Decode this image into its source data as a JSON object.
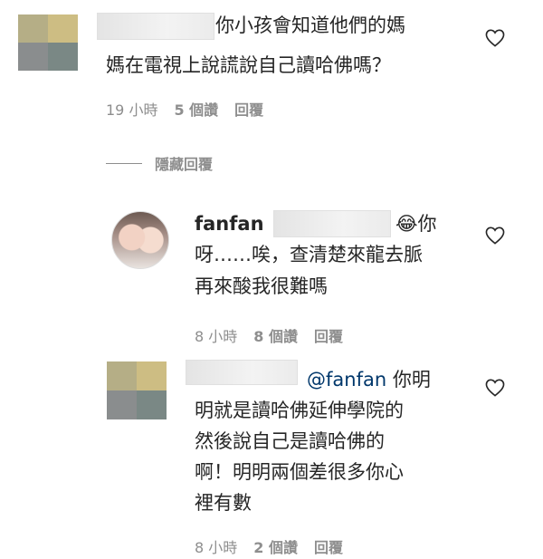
{
  "comments": [
    {
      "text_line1": "你小孩會知道他們的媽",
      "text_line2": "媽在電視上說謊說自己讀哈佛嗎？",
      "time": "19 小時",
      "likes": "5 個讚",
      "reply": "回覆",
      "avatar_colors": [
        "#b5ae86",
        "#cdbd83",
        "#8a8d8e",
        "#7a8885"
      ]
    }
  ],
  "hidden_replies_label": "隱藏回覆",
  "replies": [
    {
      "username": "fanfan",
      "text_tail": "😂你",
      "text_line2": "呀……唉，查清楚來龍去脈",
      "text_line3": "再來酸我很難嗎",
      "time": "8 小時",
      "likes": "8 個讚",
      "reply": "回覆"
    },
    {
      "mention": "@fanfan",
      "text_tail": "你明",
      "text_line2": "明就是讀哈佛延伸學院的",
      "text_line3": "然後說自己是讀哈佛的",
      "text_line4": "啊！明明兩個差很多你心",
      "text_line5": "裡有數",
      "time": "8 小時",
      "likes": "2 個讚",
      "reply": "回覆",
      "avatar_colors": [
        "#b5ae86",
        "#cdbd83",
        "#8a8d8e",
        "#7a8885"
      ]
    }
  ]
}
